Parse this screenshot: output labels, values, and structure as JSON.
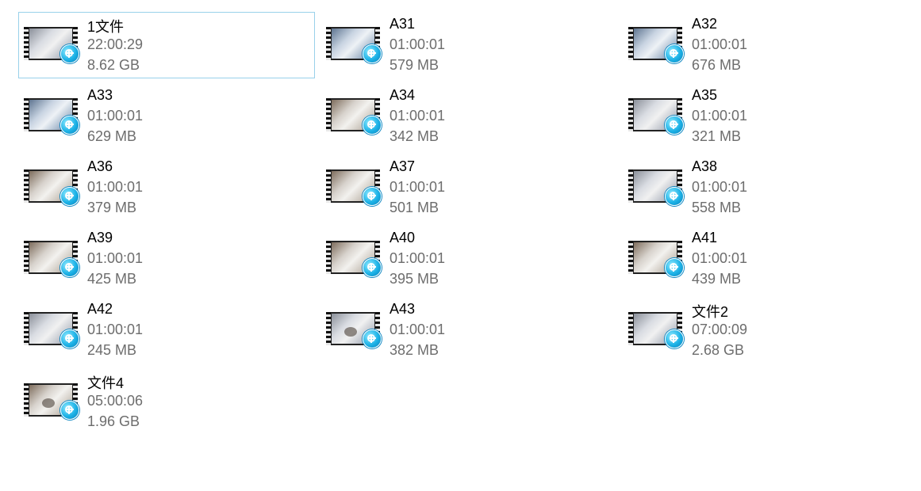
{
  "files": [
    {
      "name": "1文件",
      "duration": "22:00:29",
      "size": "8.62 GB",
      "selected": true,
      "thumb": "gray",
      "icon": "video-file-icon"
    },
    {
      "name": "A31",
      "duration": "01:00:01",
      "size": "579 MB",
      "selected": false,
      "thumb": "blue",
      "icon": "video-file-icon"
    },
    {
      "name": "A32",
      "duration": "01:00:01",
      "size": "676 MB",
      "selected": false,
      "thumb": "blue",
      "icon": "video-file-icon"
    },
    {
      "name": "A33",
      "duration": "01:00:01",
      "size": "629 MB",
      "selected": false,
      "thumb": "blue",
      "icon": "video-file-icon"
    },
    {
      "name": "A34",
      "duration": "01:00:01",
      "size": "342 MB",
      "selected": false,
      "thumb": "warm",
      "icon": "video-file-icon"
    },
    {
      "name": "A35",
      "duration": "01:00:01",
      "size": "321 MB",
      "selected": false,
      "thumb": "gray",
      "icon": "video-file-icon"
    },
    {
      "name": "A36",
      "duration": "01:00:01",
      "size": "379 MB",
      "selected": false,
      "thumb": "warm",
      "icon": "video-file-icon"
    },
    {
      "name": "A37",
      "duration": "01:00:01",
      "size": "501 MB",
      "selected": false,
      "thumb": "warm",
      "icon": "video-file-icon"
    },
    {
      "name": "A38",
      "duration": "01:00:01",
      "size": "558 MB",
      "selected": false,
      "thumb": "gray",
      "icon": "video-file-icon"
    },
    {
      "name": "A39",
      "duration": "01:00:01",
      "size": "425 MB",
      "selected": false,
      "thumb": "warm",
      "icon": "video-file-icon"
    },
    {
      "name": "A40",
      "duration": "01:00:01",
      "size": "395 MB",
      "selected": false,
      "thumb": "warm",
      "icon": "video-file-icon"
    },
    {
      "name": "A41",
      "duration": "01:00:01",
      "size": "439 MB",
      "selected": false,
      "thumb": "warm",
      "icon": "video-file-icon"
    },
    {
      "name": "A42",
      "duration": "01:00:01",
      "size": "245 MB",
      "selected": false,
      "thumb": "gray",
      "icon": "video-file-icon"
    },
    {
      "name": "A43",
      "duration": "01:00:01",
      "size": "382 MB",
      "selected": false,
      "thumb": "gray",
      "icon": "video-file-icon"
    },
    {
      "name": "文件2",
      "duration": "07:00:09",
      "size": "2.68 GB",
      "selected": false,
      "thumb": "gray",
      "icon": "video-file-icon"
    },
    {
      "name": "文件4",
      "duration": "05:00:06",
      "size": "1.96 GB",
      "selected": false,
      "thumb": "warm",
      "icon": "video-file-icon"
    }
  ],
  "colors": {
    "selection_border": "#99d1ea",
    "name_text": "#000000",
    "meta_text": "#6d6d6d",
    "badge_accent": "#1bb1e6"
  }
}
